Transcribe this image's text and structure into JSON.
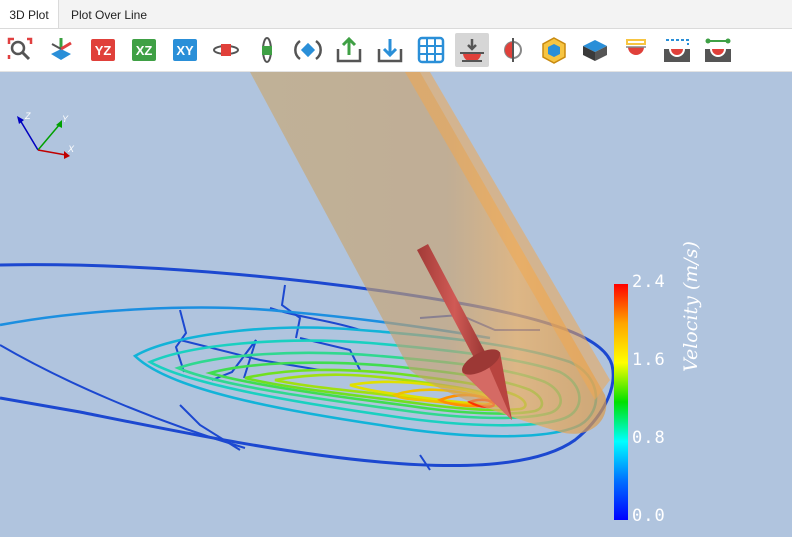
{
  "tabs": [
    {
      "label": "3D Plot",
      "active": true
    },
    {
      "label": "Plot Over Line",
      "active": false
    }
  ],
  "toolbar": {
    "buttons": [
      {
        "icon": "zoom-extents-icon"
      },
      {
        "icon": "isometric-view-icon"
      },
      {
        "icon": "view-yz-icon",
        "label": "YZ"
      },
      {
        "icon": "view-xz-icon",
        "label": "XZ"
      },
      {
        "icon": "view-xy-icon",
        "label": "XY"
      },
      {
        "icon": "rotate-x-icon"
      },
      {
        "icon": "rotate-y-icon"
      },
      {
        "icon": "rotate-z-icon"
      },
      {
        "icon": "export-icon"
      },
      {
        "icon": "import-icon"
      },
      {
        "icon": "grid-icon"
      },
      {
        "icon": "clip-plane-icon",
        "pressed": true
      },
      {
        "icon": "slice-icon"
      },
      {
        "icon": "box-view-icon"
      },
      {
        "icon": "solid-view-icon"
      },
      {
        "icon": "cutaway-icon"
      },
      {
        "icon": "section-view-icon"
      },
      {
        "icon": "probe-line-icon"
      }
    ],
    "view_labels": {
      "yz": "YZ",
      "xz": "XZ",
      "xy": "XY"
    }
  },
  "axes_triad": {
    "x": "X",
    "y": "Y",
    "z": "Z"
  },
  "colorbar": {
    "title": "Velocity (m/s)",
    "ticks": [
      "2.4",
      "1.6",
      "0.8",
      "0.0"
    ],
    "min": 0.0,
    "max": 2.4,
    "colors": [
      "#ff0000",
      "#ffa500",
      "#ffff00",
      "#00e000",
      "#00ffff",
      "#0070ff",
      "#0000ff"
    ]
  },
  "colors": {
    "background": "#b0c4de",
    "pile": "#c8a06a",
    "arrow": "#c0504d"
  }
}
